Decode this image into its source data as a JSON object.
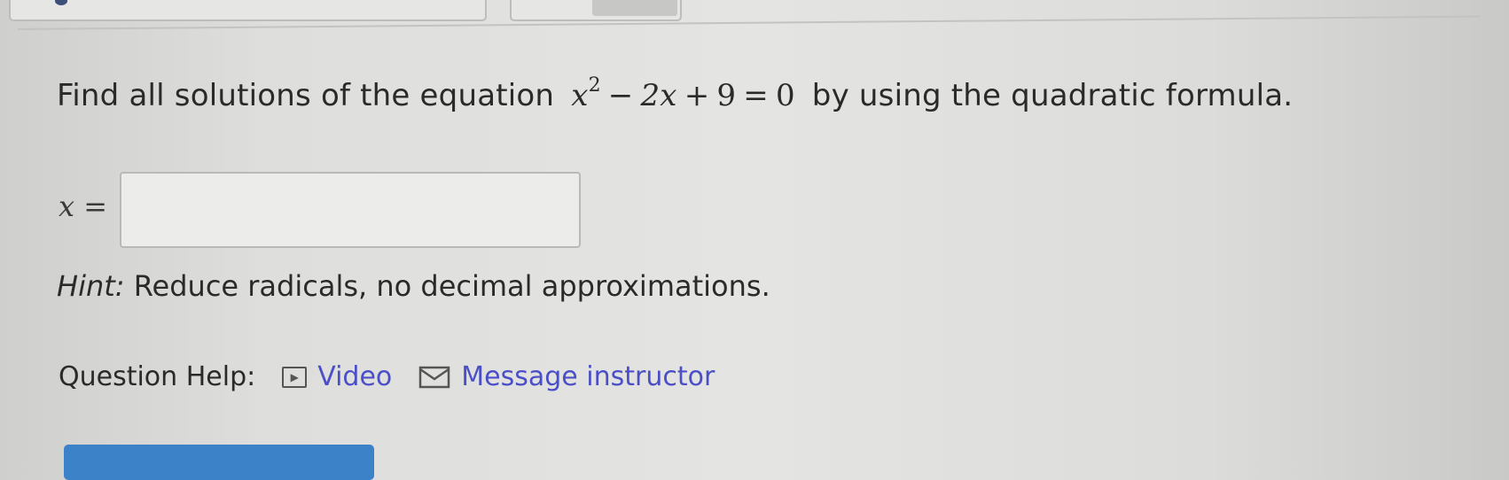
{
  "question": {
    "prefix": "Find all solutions of the equation",
    "equation": {
      "var": "x",
      "exp": "2",
      "op1": "−",
      "term2": "2x",
      "op2": "+",
      "const": "9",
      "eq": "=",
      "rhs": "0"
    },
    "suffix": "by using the quadratic formula."
  },
  "answer": {
    "label": "x =",
    "value": ""
  },
  "hint": {
    "label": "Hint:",
    "text": "Reduce radicals, no decimal approximations."
  },
  "help": {
    "label": "Question Help:",
    "video_label": "Video",
    "message_label": "Message instructor"
  },
  "colors": {
    "link": "#4a4fc7",
    "submit": "#3b82c9"
  }
}
